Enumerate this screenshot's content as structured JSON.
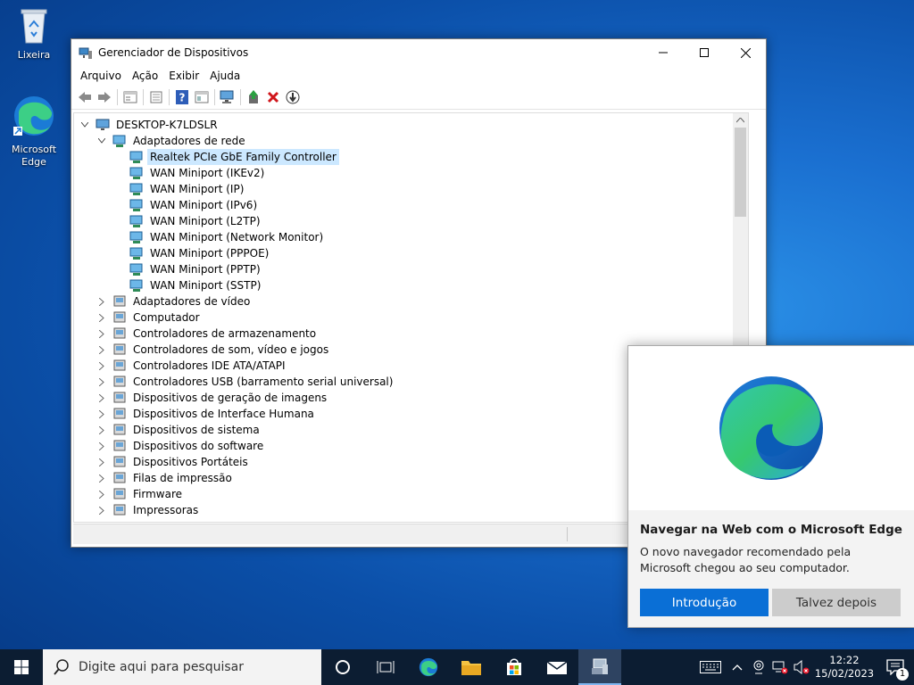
{
  "desktop": {
    "icons": [
      {
        "label": "Lixeira"
      },
      {
        "label": "Microsoft Edge"
      }
    ]
  },
  "window": {
    "title": "Gerenciador de Dispositivos",
    "menu": [
      "Arquivo",
      "Ação",
      "Exibir",
      "Ajuda"
    ],
    "toolbar_icons": [
      "back-icon",
      "forward-icon",
      "properties-icon",
      "list-icon",
      "help-icon",
      "view-icon",
      "scan-hardware-icon",
      "update-driver-icon",
      "uninstall-icon",
      "disable-icon"
    ],
    "tree": {
      "root": "DESKTOP-K7LDSLR",
      "network_category": "Adaptadores de rede",
      "network_devices": [
        "Realtek PCIe GbE Family Controller",
        "WAN Miniport (IKEv2)",
        "WAN Miniport (IP)",
        "WAN Miniport (IPv6)",
        "WAN Miniport (L2TP)",
        "WAN Miniport (Network Monitor)",
        "WAN Miniport (PPPOE)",
        "WAN Miniport (PPTP)",
        "WAN Miniport (SSTP)"
      ],
      "selected": "Realtek PCIe GbE Family Controller",
      "categories": [
        "Adaptadores de vídeo",
        "Computador",
        "Controladores de armazenamento",
        "Controladores de som, vídeo e jogos",
        "Controladores IDE ATA/ATAPI",
        "Controladores USB (barramento serial universal)",
        "Dispositivos de geração de imagens",
        "Dispositivos de Interface Humana",
        "Dispositivos de sistema",
        "Dispositivos do software",
        "Dispositivos Portáteis",
        "Filas de impressão",
        "Firmware",
        "Impressoras"
      ]
    }
  },
  "edge_popup": {
    "title": "Navegar na Web com o Microsoft Edge",
    "body": "O novo navegador recomendado pela Microsoft chegou ao seu computador.",
    "primary_button": "Introdução",
    "secondary_button": "Talvez depois"
  },
  "taskbar": {
    "search_placeholder": "Digite aqui para pesquisar",
    "time": "12:22",
    "date": "15/02/2023",
    "notification_count": "1"
  },
  "colors": {
    "accent": "#0a6fd6",
    "selection": "#cce8ff",
    "taskbar": "#0c1d32"
  }
}
